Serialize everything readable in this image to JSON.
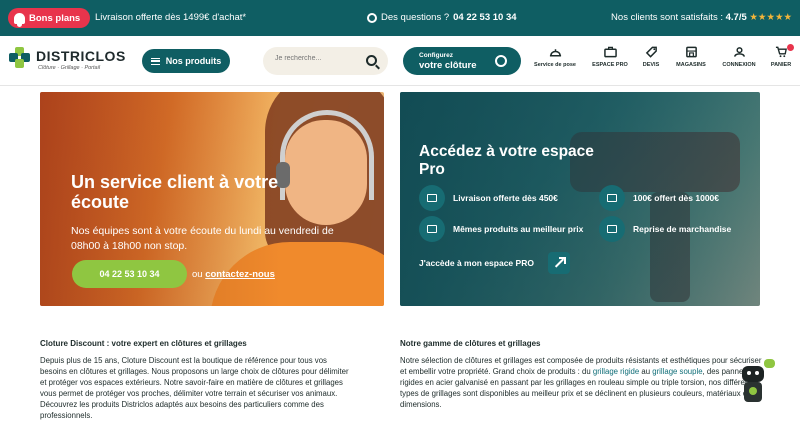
{
  "topbar": {
    "bons_plans": "Bons plans",
    "livraison": "Livraison offerte dès 1499€ d'achat*",
    "questions_label": "Des questions ?",
    "phone": "04 22 53 10 34",
    "satisfaits": "Nos clients sont satisfaits :",
    "rating": "4.7/5",
    "stars": "★★★★★"
  },
  "header": {
    "logo_name": "DISTRICLOS",
    "logo_tagline": "Clôture · Grillage · Portail",
    "produits_button": "Nos produits",
    "search_placeholder": "Je recherche...",
    "config_line1": "Configurez",
    "config_line2": "votre clôture",
    "nav": [
      {
        "label": "Service de pose",
        "icon": "helmet-icon"
      },
      {
        "label": "ESPACE PRO",
        "icon": "briefcase-icon"
      },
      {
        "label": "DEVIS",
        "icon": "tag-icon"
      },
      {
        "label": "MAGASINS",
        "icon": "store-icon"
      },
      {
        "label": "CONNEXION",
        "icon": "user-icon"
      },
      {
        "label": "PANIER",
        "icon": "cart-icon"
      }
    ]
  },
  "banner_left": {
    "title": "Un service client à votre écoute",
    "description": "Nos équipes sont à votre écoute du lundi au vendredi de 08h00 à 18h00 non stop.",
    "phone_button": "04 22 53 10 34",
    "ou": "ou",
    "contact_link": "contactez-nous"
  },
  "banner_right": {
    "title": "Accédez à votre espace Pro",
    "features": [
      {
        "label": "Livraison offerte dès 450€",
        "icon": "truck-icon"
      },
      {
        "label": "100€ offert dès 1000€",
        "icon": "gift-icon"
      },
      {
        "label": "Mêmes produits au meilleur prix",
        "icon": "price-tag-icon"
      },
      {
        "label": "Reprise de marchandise",
        "icon": "box-icon"
      }
    ],
    "cta": "J'accède à mon espace PRO"
  },
  "content": {
    "left_title": "Cloture Discount : votre expert en clôtures et grillages",
    "left_text": "Depuis plus de 15 ans, Cloture Discount est la boutique de référence pour tous vos besoins en clôtures et grillages. Nous proposons un large choix de clôtures pour délimiter et protéger vos espaces extérieurs. Notre savoir-faire en matière de clôtures et grillages vous permet de protéger vos proches, délimiter votre terrain et sécuriser vos animaux. Découvrez les produits Districlos adaptés aux besoins des particuliers comme des professionnels.",
    "right_title": "Notre gamme de clôtures et grillages",
    "right_text_1": "Notre sélection de clôtures et grillages est composée de produits résistants et esthétiques pour sécuriser et embellir votre propriété. Grand choix de produits : du ",
    "right_link_1": "grillage rigide",
    "right_text_2": " au ",
    "right_link_2": "grillage souple",
    "right_text_3": ", des panneaux rigides en acier galvanisé en passant par les grillages en rouleau simple ou triple torsion, nos différents types de grillages sont disponibles au meilleur prix et se déclinent en plusieurs couleurs, matériaux et dimensions."
  },
  "colors": {
    "brand_teal": "#0f5e63",
    "promo_red": "#e8344c",
    "cta_green": "#8fc641",
    "star_yellow": "#f3b53a"
  }
}
